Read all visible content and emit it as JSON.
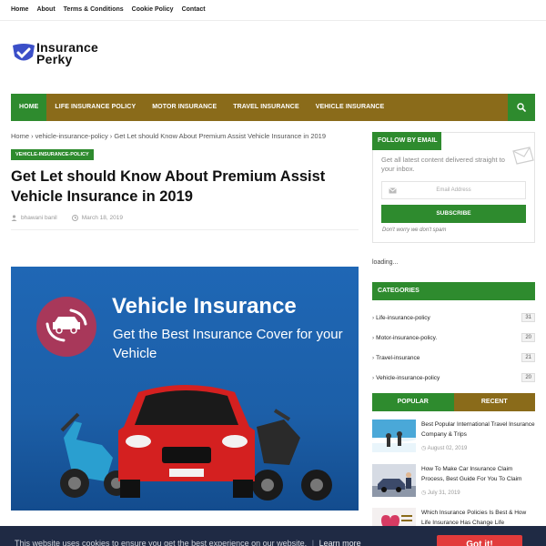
{
  "top_links": [
    "Home",
    "About",
    "Terms & Conditions",
    "Cookie Policy",
    "Contact"
  ],
  "logo": {
    "line1": "Insurance",
    "line2": "Perky"
  },
  "nav": {
    "items": [
      "HOME",
      "LIFE INSURANCE POLICY",
      "MOTOR INSURANCE",
      "TRAVEL INSURANCE",
      "VEHICLE INSURANCE"
    ],
    "active": "HOME"
  },
  "breadcrumb": "Home › vehicle-insurance-policy › Get Let should Know About Premium Assist Vehicle Insurance in 2019",
  "post": {
    "tag": "VEHICLE-INSURANCE-POLICY",
    "title": "Get Let should Know About Premium Assist Vehicle Insurance in 2019",
    "author": "bhawani banil",
    "date": "March 18, 2019"
  },
  "hero": {
    "heading": "Vehicle Insurance",
    "subheading": "Get the Best Insurance Cover for your Vehicle"
  },
  "sidebar": {
    "follow": {
      "title": "FOLLOW BY EMAIL",
      "description": "Get all latest content delivered straight to your inbox.",
      "email_placeholder": "Email Address",
      "button": "SUBSCRIBE",
      "note": "Don't worry we don't spam"
    },
    "loading": "loading...",
    "categories": {
      "title": "CATEGORIES",
      "items": [
        {
          "label": "Life-insurance-policy",
          "count": "31"
        },
        {
          "label": "Motor-insurance-policy.",
          "count": "20"
        },
        {
          "label": "Travel-insurance",
          "count": "21"
        },
        {
          "label": "Vehicle-insurance-policy",
          "count": "20"
        }
      ]
    },
    "tabs": [
      "POPULAR",
      "RECENT"
    ],
    "popular": [
      {
        "title": "Best Popular International Travel Insurance Company & Trips",
        "date": "August 02, 2019"
      },
      {
        "title": "How To Make Car Insurance Claim Process, Best Guide For You To Claim",
        "date": "July 31, 2019"
      },
      {
        "title": "Which Insurance Policies Is Best & How Life Insurance Has Change Life",
        "date": ""
      }
    ]
  },
  "cookie": {
    "text": "This website uses cookies to ensure you get the best experience on our website.",
    "link": "Learn more",
    "button": "Got it!"
  },
  "colors": {
    "green": "#2e8b2e",
    "olive": "#8a6b1a",
    "cookie_bg": "#1f2a44",
    "cookie_btn": "#e23b3b"
  }
}
